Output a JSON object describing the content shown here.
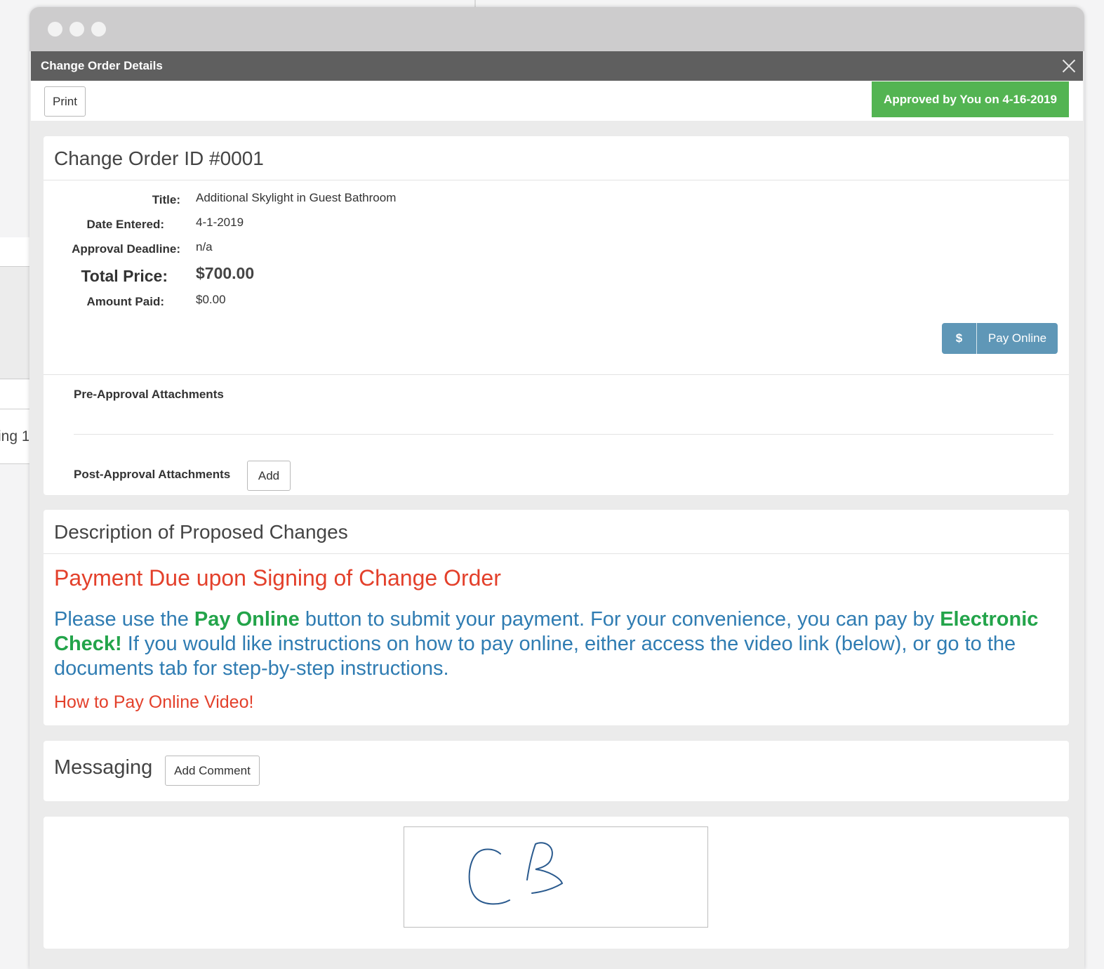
{
  "background": {
    "fragment_text": "ing 1"
  },
  "modal": {
    "title": "Change Order Details"
  },
  "toolbar": {
    "print_label": "Print",
    "status_badge": "Approved by You on 4-16-2019"
  },
  "details": {
    "heading": "Change Order ID #0001",
    "fields": [
      {
        "label": "Title:",
        "value": "Additional Skylight in Guest Bathroom"
      },
      {
        "label": "Date Entered:",
        "value": "4-1-2019"
      },
      {
        "label": "Approval Deadline:",
        "value": "n/a"
      },
      {
        "label": "Total Price:",
        "value": "$700.00"
      },
      {
        "label": "Amount Paid:",
        "value": "$0.00"
      }
    ],
    "pay_icon": "$",
    "pay_label": "Pay Online",
    "pre_approval_label": "Pre-Approval Attachments",
    "post_approval_label": "Post-Approval Attachments",
    "add_label": "Add"
  },
  "description": {
    "heading": "Description of Proposed Changes",
    "subheading": "Payment Due upon Signing of Change Order",
    "body_part1": "Please use the ",
    "body_bold1": "Pay Online",
    "body_part2": " button to submit your payment. For your convenience, you can pay by ",
    "body_bold2": "Electronic Check!",
    "body_part3": " If you would like instructions on how to pay online, either access the video link (below), or go to the documents tab for step-by-step instructions.",
    "video_link": "How to Pay Online Video!"
  },
  "messaging": {
    "title": "Messaging",
    "add_comment_label": "Add Comment"
  },
  "signature": {
    "initials": "CB"
  },
  "colors": {
    "approved_green": "#53b452",
    "pay_blue": "#5f97b7",
    "heading_red": "#e3402b",
    "body_blue": "#2f7cb2",
    "bold_green": "#23a44a"
  }
}
